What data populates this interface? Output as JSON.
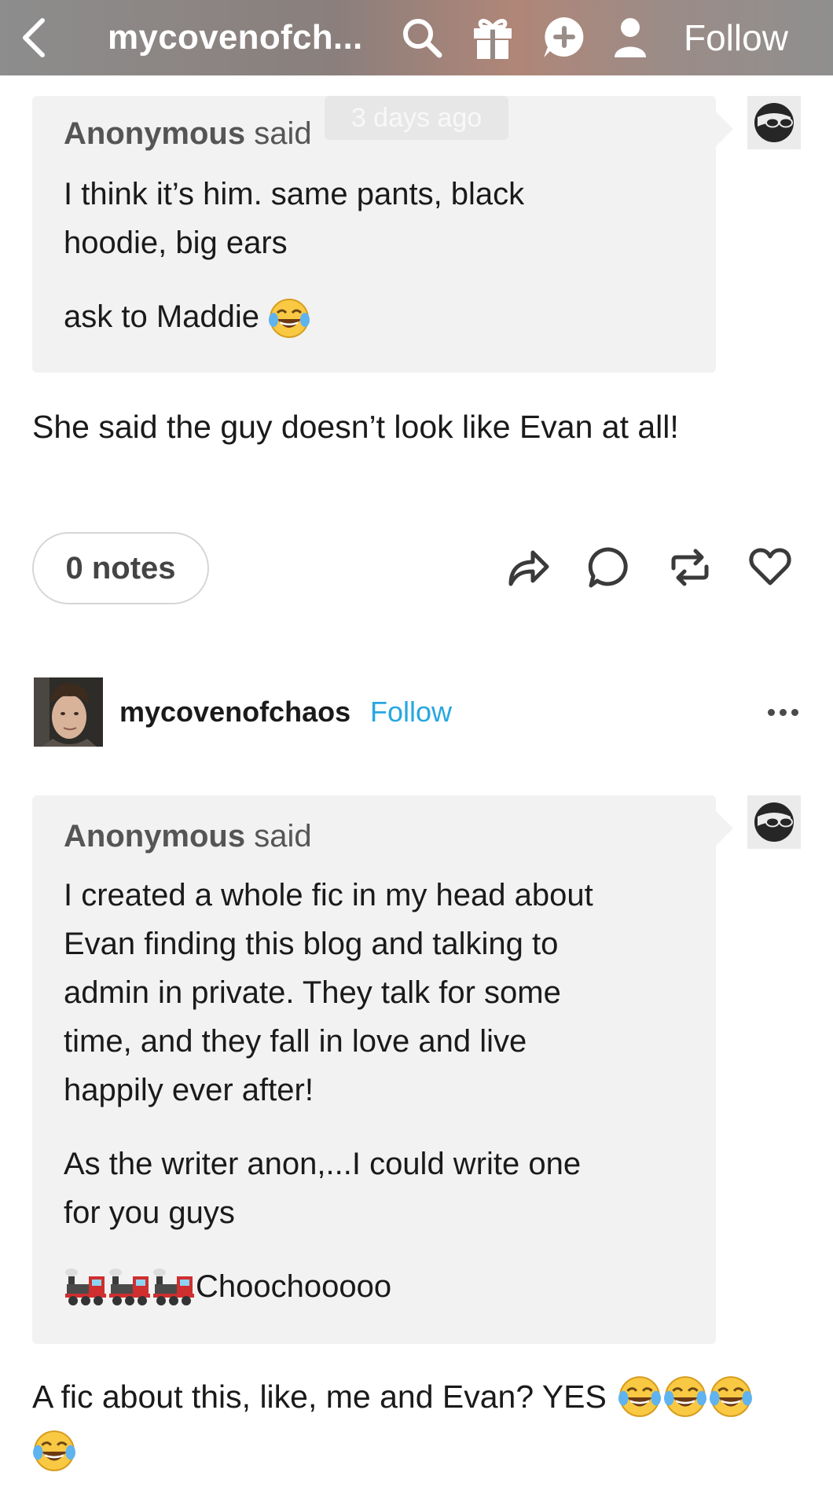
{
  "topbar": {
    "blog_name": "mycovenofch...",
    "follow_label": "Follow",
    "icons": [
      "back-chevron-icon",
      "search-icon",
      "gift-icon",
      "add-message-icon",
      "user-icon"
    ]
  },
  "post1": {
    "faded_stamp": "3 days ago",
    "ask": {
      "sender": "Anonymous",
      "said": "said",
      "lines": [
        "I think it’s him. same pants, black",
        "hoodie, big ears"
      ],
      "closing": "ask to Maddie",
      "closing_emoji": "face-with-tears-of-joy"
    },
    "reply": "She said the guy doesn’t look like Evan at all!",
    "notes_label": "0 notes",
    "actions": [
      "share-icon",
      "comment-icon",
      "reblog-icon",
      "heart-icon"
    ]
  },
  "post2": {
    "author": "mycovenofchaos",
    "follow_label": "Follow",
    "ask": {
      "sender": "Anonymous",
      "said": "said",
      "para1": [
        "I created a whole fic in my head about",
        "Evan finding this blog and talking to",
        "admin in private. They talk for some",
        "time, and they fall in love and live",
        "happily ever after!"
      ],
      "para2": [
        "As the writer anon,...I could write one",
        "for you guys"
      ],
      "train_text": "Choochooooo",
      "train_emoji": "steam-locomotive"
    },
    "reply_line1": "A fic about this, like, me and Evan? YES",
    "reply_emoji": "face-with-tears-of-joy"
  },
  "colors": {
    "follow_blue": "#27a7e0",
    "ask_background": "#f2f2f2",
    "notes_border": "#d6d6d6"
  }
}
